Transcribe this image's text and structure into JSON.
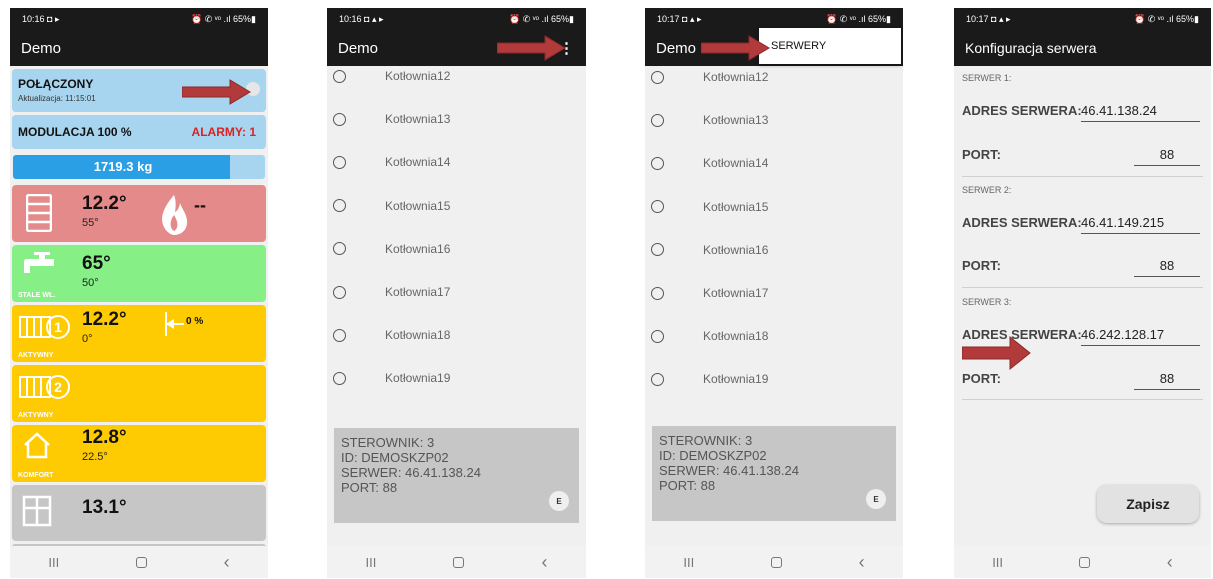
{
  "phone1": {
    "status": {
      "time": "10:16",
      "icons": "◘ ▸",
      "right": "⏰ ✆ ᵛᵒ .ıl 65%▮"
    },
    "title": "Demo",
    "connection": {
      "status": "POŁĄCZONY",
      "update": "Aktualizacja: 11:15:01"
    },
    "modulation": {
      "label": "MODULACJA  100 %",
      "alarms": "ALARMY: 1"
    },
    "fuel": {
      "label": "1719.3 kg",
      "fill_fraction": 0.86
    },
    "boiler": {
      "temp": "12.2°",
      "set": "55°",
      "flame": "--"
    },
    "water": {
      "temp": "65°",
      "set": "50°",
      "mode": "STALE WŁ."
    },
    "circuit1": {
      "temp": "12.2°",
      "set": "0°",
      "valve": "0 %",
      "mode": "AKTYWNY"
    },
    "circuit2": {
      "mode": "AKTYWNY"
    },
    "room": {
      "temp": "12.8°",
      "set": "22.5°",
      "mode": "KOMFORT"
    },
    "outside": {
      "temp": "13.1°"
    },
    "colors": {
      "header": "#1a1a1a",
      "blue_tile": "#a7d4ee",
      "red_tile": "#e58a8a",
      "green_tile": "#86ef86",
      "yellow_tile": "#fecb02",
      "gray_tile": "#c6c6c6",
      "alarm": "#e02020",
      "fuel_bar": "#2a9fe6"
    }
  },
  "phone2": {
    "status": {
      "time": "10:16",
      "icons": "◘ ▴ ▸",
      "right": "⏰ ✆ ᵛᵒ .ıl 65%▮"
    },
    "title": "Demo",
    "items": [
      "Kotłownia12",
      "Kotłownia13",
      "Kotłownia14",
      "Kotłownia15",
      "Kotłownia16",
      "Kotłownia17",
      "Kotłownia18",
      "Kotłownia19"
    ],
    "info": {
      "line1": "STEROWNIK:  3",
      "line2": "ID:  DEMOSKZP02",
      "line3": "SERWER:  46.41.138.24",
      "line4": "PORT:  88",
      "button": "E"
    }
  },
  "phone3": {
    "status": {
      "time": "10:17",
      "icons": "◘ ▴ ▸",
      "right": "⏰ ✆ ᵛᵒ .ıl 65%▮"
    },
    "title": "Demo",
    "menu_item": "SERWERY",
    "items": [
      "Kotłownia12",
      "Kotłownia13",
      "Kotłownia14",
      "Kotłownia15",
      "Kotłownia16",
      "Kotłownia17",
      "Kotłownia18",
      "Kotłownia19"
    ],
    "info": {
      "line1": "STEROWNIK:  3",
      "line2": "ID:  DEMOSKZP02",
      "line3": "SERWER:  46.41.138.24",
      "line4": "PORT:  88",
      "button": "E"
    }
  },
  "phone4": {
    "status": {
      "time": "10:17",
      "icons": "◘ ▴ ▸",
      "right": "⏰ ✆ ᵛᵒ .ıl 65%▮"
    },
    "title": "Konfiguracja serwera",
    "servers": [
      {
        "section": "SERWER 1:",
        "address_label": "ADRES SERWERA:",
        "address": "46.41.138.24",
        "port_label": "PORT:",
        "port": "88"
      },
      {
        "section": "SERWER 2:",
        "address_label": "ADRES SERWERA:",
        "address": "46.41.149.215",
        "port_label": "PORT:",
        "port": "88"
      },
      {
        "section": "SERWER 3:",
        "address_label": "ADRES SERWERA:",
        "address": "46.242.128.17",
        "port_label": "PORT:",
        "port": "88"
      }
    ],
    "save_label": "Zapisz"
  },
  "nav": {
    "recent": "III",
    "back": "‹"
  },
  "icons": [
    "more-vert-icon",
    "radiator-icon",
    "flame-icon",
    "tap-icon",
    "circuit-1-icon",
    "circuit-2-icon",
    "valve-icon",
    "house-icon",
    "window-icon",
    "annotation-arrow"
  ]
}
